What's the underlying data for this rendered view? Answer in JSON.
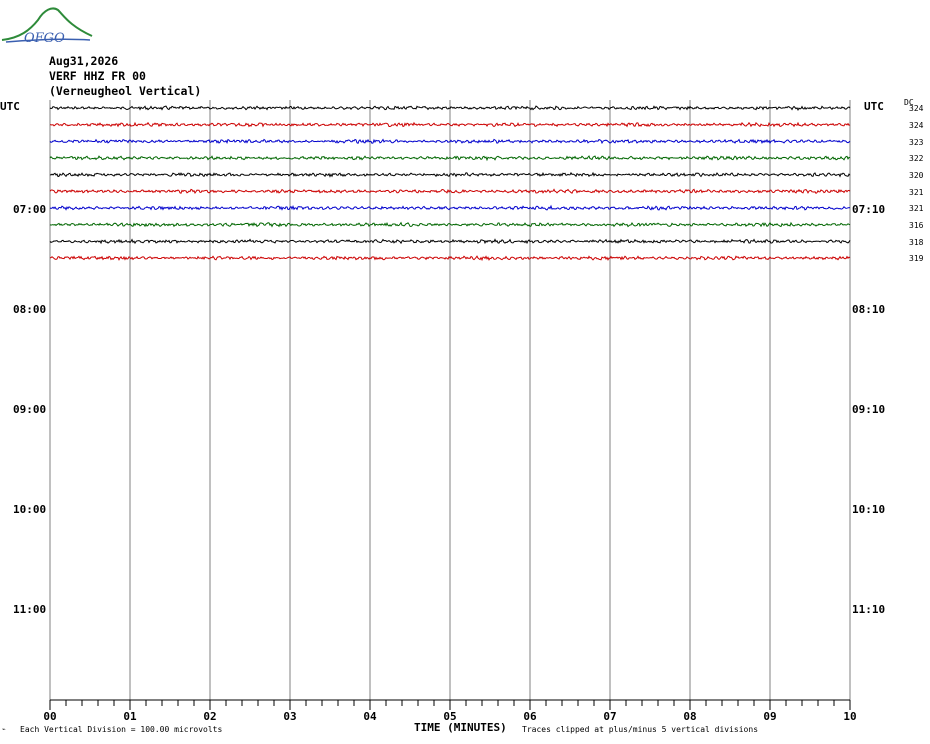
{
  "logo": {
    "text": "OFGO"
  },
  "header": {
    "date": "Aug31,2026",
    "station": "VERF HHZ FR 00",
    "location": "(Verneugheol Vertical)"
  },
  "left_axis": {
    "utc_label": "UTC",
    "hour_labels": [
      "07:00",
      "08:00",
      "09:00",
      "10:00",
      "11:00"
    ]
  },
  "right_axis": {
    "utc_label": "UTC",
    "hour_labels": [
      "07:10",
      "08:10",
      "09:10",
      "10:10",
      "11:10"
    ],
    "dc_label": "DC",
    "dc_values": [
      "324",
      "324",
      "323",
      "322",
      "320",
      "321",
      "321",
      "316",
      "318",
      "319"
    ]
  },
  "footer": {
    "division_text": "Each Vertical Division =  100.00 microvolts",
    "xaxis_title": "TIME (MINUTES)",
    "clip_text": "Traces clipped at plus/minus 5 vertical divisions"
  },
  "chart_data": {
    "type": "line",
    "title": "",
    "xlabel": "TIME (MINUTES)",
    "ylabel": "",
    "x_tick_labels": [
      "00",
      "01",
      "02",
      "03",
      "04",
      "05",
      "06",
      "07",
      "08",
      "09",
      "10"
    ],
    "xlim": [
      0,
      10
    ],
    "trace_count": 10,
    "trace_colors": [
      "#000000",
      "#cc0000",
      "#0000cc",
      "#006600",
      "#000000",
      "#cc0000",
      "#0000cc",
      "#006600",
      "#000000",
      "#cc0000"
    ],
    "gridlines": "vertical, every minute",
    "series": [
      {
        "values": [
          0,
          0,
          0,
          0,
          0,
          0,
          0,
          0,
          0,
          0,
          0
        ]
      },
      {
        "values": [
          0,
          0,
          0,
          0,
          0,
          0,
          0,
          0,
          0,
          0,
          0
        ]
      },
      {
        "values": [
          0,
          0,
          0,
          0,
          0,
          0,
          0,
          0,
          0,
          0,
          0
        ]
      },
      {
        "values": [
          0,
          0,
          0,
          0,
          0,
          0,
          0,
          0,
          0,
          0,
          0
        ]
      },
      {
        "values": [
          0,
          0,
          0,
          0,
          0,
          0,
          0,
          0,
          0,
          0,
          0
        ]
      },
      {
        "values": [
          0,
          0,
          0,
          0,
          0,
          0,
          0,
          0,
          0,
          0,
          0
        ]
      },
      {
        "values": [
          0,
          0,
          0,
          0,
          0,
          0,
          0,
          0,
          0,
          0,
          0
        ]
      },
      {
        "values": [
          0,
          0,
          0,
          0,
          0,
          0,
          0,
          0,
          0,
          0,
          0
        ]
      },
      {
        "values": [
          0,
          0,
          0,
          0,
          0,
          0,
          0,
          0,
          0,
          0,
          0
        ]
      },
      {
        "values": [
          0,
          0,
          0,
          0,
          0,
          0,
          0,
          0,
          0,
          0,
          0
        ]
      }
    ]
  }
}
